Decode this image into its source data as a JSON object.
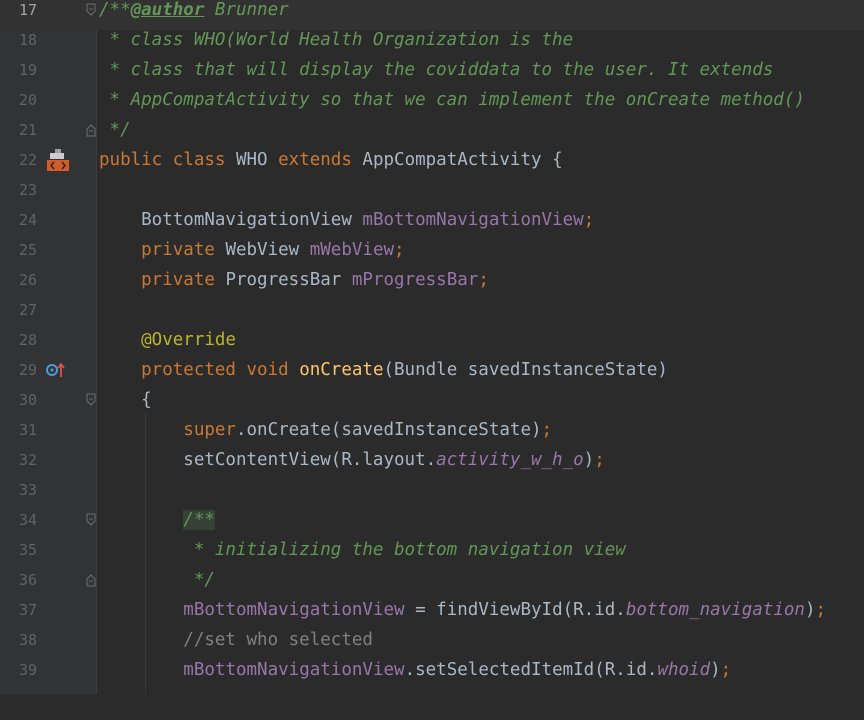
{
  "editor": {
    "lines": [
      {
        "n": "17",
        "segs": [
          {
            "t": "/**",
            "c": "cm"
          },
          {
            "t": "@author",
            "c": "tag"
          },
          {
            "t": " Brunner",
            "c": "cm"
          }
        ]
      },
      {
        "n": "18",
        "segs": [
          {
            "t": " * class WHO(World Health Organization is the",
            "c": "cm"
          }
        ]
      },
      {
        "n": "19",
        "segs": [
          {
            "t": " * class that will display the coviddata to the user. It extends",
            "c": "cm"
          }
        ]
      },
      {
        "n": "20",
        "segs": [
          {
            "t": " * AppCompatActivity so that we can implement the onCreate method()",
            "c": "cm"
          }
        ]
      },
      {
        "n": "21",
        "segs": [
          {
            "t": " */",
            "c": "cm"
          }
        ]
      },
      {
        "n": "22",
        "segs": [
          {
            "t": "public class ",
            "c": "kw"
          },
          {
            "t": "WHO ",
            "c": "pl"
          },
          {
            "t": "extends ",
            "c": "kw"
          },
          {
            "t": "AppCompatActivity {",
            "c": "pl"
          }
        ]
      },
      {
        "n": "23",
        "segs": []
      },
      {
        "n": "24",
        "segs": [
          {
            "t": "    BottomNavigationView ",
            "c": "pl"
          },
          {
            "t": "mBottomNavigationView",
            "c": "fld"
          },
          {
            "t": ";",
            "c": "kw"
          }
        ]
      },
      {
        "n": "25",
        "segs": [
          {
            "t": "    private ",
            "c": "kw"
          },
          {
            "t": "WebView ",
            "c": "pl"
          },
          {
            "t": "mWebView",
            "c": "fld"
          },
          {
            "t": ";",
            "c": "kw"
          }
        ]
      },
      {
        "n": "26",
        "segs": [
          {
            "t": "    private ",
            "c": "kw"
          },
          {
            "t": "ProgressBar ",
            "c": "pl"
          },
          {
            "t": "mProgressBar",
            "c": "fld"
          },
          {
            "t": ";",
            "c": "kw"
          }
        ]
      },
      {
        "n": "27",
        "segs": []
      },
      {
        "n": "28",
        "segs": [
          {
            "t": "    @Override",
            "c": "ann"
          }
        ]
      },
      {
        "n": "29",
        "segs": [
          {
            "t": "    protected void ",
            "c": "kw"
          },
          {
            "t": "onCreate",
            "c": "mth"
          },
          {
            "t": "(Bundle savedInstanceState)",
            "c": "pl"
          }
        ]
      },
      {
        "n": "30",
        "segs": [
          {
            "t": "    {",
            "c": "pl"
          }
        ]
      },
      {
        "n": "31",
        "segs": [
          {
            "t": "        super",
            "c": "kw"
          },
          {
            "t": ".onCreate(savedInstanceState)",
            "c": "pl"
          },
          {
            "t": ";",
            "c": "kw"
          }
        ]
      },
      {
        "n": "32",
        "segs": [
          {
            "t": "        setContentView(R.layout.",
            "c": "pl"
          },
          {
            "t": "activity_w_h_o",
            "c": "sfld"
          },
          {
            "t": ")",
            "c": "pl"
          },
          {
            "t": ";",
            "c": "kw"
          }
        ]
      },
      {
        "n": "33",
        "segs": []
      },
      {
        "n": "34",
        "segs": [
          {
            "t": "        ",
            "c": "pl"
          },
          {
            "t": "/**",
            "c": "cm",
            "hl": true
          }
        ]
      },
      {
        "n": "35",
        "segs": [
          {
            "t": "         * initializing the bottom navigation view",
            "c": "cm"
          }
        ]
      },
      {
        "n": "36",
        "segs": [
          {
            "t": "         */",
            "c": "cm"
          }
        ]
      },
      {
        "n": "37",
        "segs": [
          {
            "t": "        ",
            "c": "pl"
          },
          {
            "t": "mBottomNavigationView",
            "c": "fld"
          },
          {
            "t": " = findViewById(R.id.",
            "c": "pl"
          },
          {
            "t": "bottom_navigation",
            "c": "sfld"
          },
          {
            "t": ")",
            "c": "pl"
          },
          {
            "t": ";",
            "c": "kw"
          }
        ]
      },
      {
        "n": "38",
        "segs": [
          {
            "t": "        //set who selected",
            "c": "lc"
          }
        ]
      },
      {
        "n": "39",
        "segs": [
          {
            "t": "        ",
            "c": "pl"
          },
          {
            "t": "mBottomNavigationView",
            "c": "fld"
          },
          {
            "t": ".setSelectedItemId(R.id.",
            "c": "pl"
          },
          {
            "t": "whoid",
            "c": "sfld"
          },
          {
            "t": ")",
            "c": "pl"
          },
          {
            "t": ";",
            "c": "kw"
          }
        ]
      }
    ],
    "current_line": "17",
    "fold_markers": {
      "17": "start",
      "21": "end",
      "30": "start",
      "34": "start",
      "36": "end"
    },
    "gutter_icons": {
      "22": "android-layout-icon",
      "29": "override-method-icon"
    }
  },
  "colors": {
    "background": "#2b2b2b",
    "gutter": "#313335",
    "keyword": "#cc7832",
    "comment": "#629755",
    "field": "#9876aa",
    "method": "#ffc66d",
    "annotation": "#bbb529",
    "text": "#a9b7c6"
  }
}
